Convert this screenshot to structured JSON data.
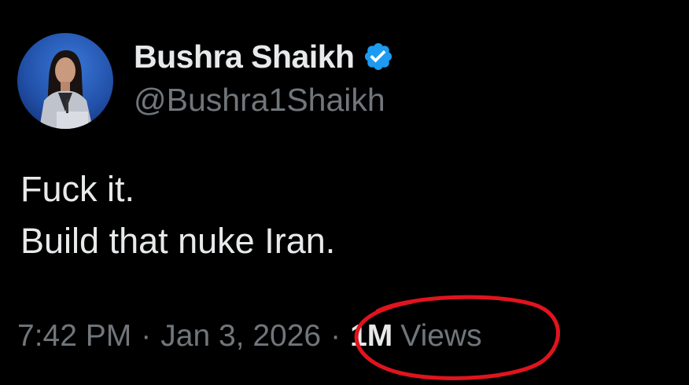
{
  "author": {
    "display_name": "Bushra Shaikh",
    "handle": "@Bushra1Shaikh",
    "verified_icon": "verified-badge-icon",
    "avatar": "profile-photo"
  },
  "tweet": {
    "lines": [
      "Fuck it.",
      "Build that nuke Iran."
    ]
  },
  "meta": {
    "time": "7:42 PM",
    "separator": "·",
    "date": "Jan 3, 2026",
    "views_count": "1M",
    "views_label": "Views"
  },
  "annotation": {
    "shape": "hand-drawn ellipse",
    "color": "#e0141e",
    "target": "views"
  },
  "colors": {
    "background": "#000000",
    "primary_text": "#e7e9ea",
    "secondary_text": "#71767b",
    "verified_blue": "#1d9bf0"
  }
}
